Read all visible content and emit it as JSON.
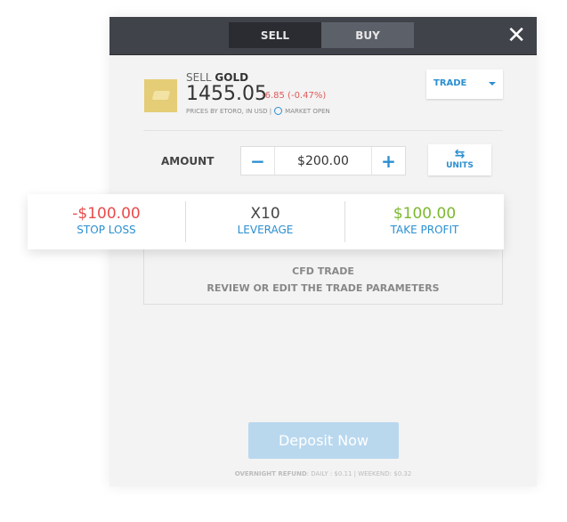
{
  "header": {
    "tabs": [
      {
        "label": "SELL",
        "active": true
      },
      {
        "label": "BUY",
        "active": false
      }
    ],
    "close_icon": "close-icon"
  },
  "instrument": {
    "action": "SELL",
    "name": "GOLD",
    "price": "1455.05",
    "change": "-6.85 (-0.47%)",
    "source": "PRICES BY ETORO, IN USD |",
    "status": "MARKET OPEN",
    "icon": "gold-bar-icon"
  },
  "trade_dropdown": {
    "label": "TRADE"
  },
  "amount": {
    "label": "AMOUNT",
    "value": "$200.00",
    "minus": "−",
    "plus": "+"
  },
  "units_button": {
    "label": "UNITS",
    "icon": "swap-arrows-icon"
  },
  "params": {
    "stop_loss": {
      "value": "-$100.00",
      "label": "STOP LOSS"
    },
    "leverage": {
      "value": "X10",
      "label": "LEVERAGE"
    },
    "take_profit": {
      "value": "$100.00",
      "label": "TAKE PROFIT"
    }
  },
  "cfd": {
    "title": "CFD TRADE",
    "subtitle": "REVIEW OR EDIT THE TRADE PARAMETERS"
  },
  "deposit_button": {
    "label": "Deposit Now"
  },
  "overnight": {
    "label": "OVERNIGHT REFUND",
    "text": ": DAILY : $0.11 | WEEKEND: $0.32"
  },
  "colors": {
    "accent": "#2b8fd0",
    "negative": "#e94b4b",
    "positive": "#7cb82f",
    "header": "#40434a"
  }
}
